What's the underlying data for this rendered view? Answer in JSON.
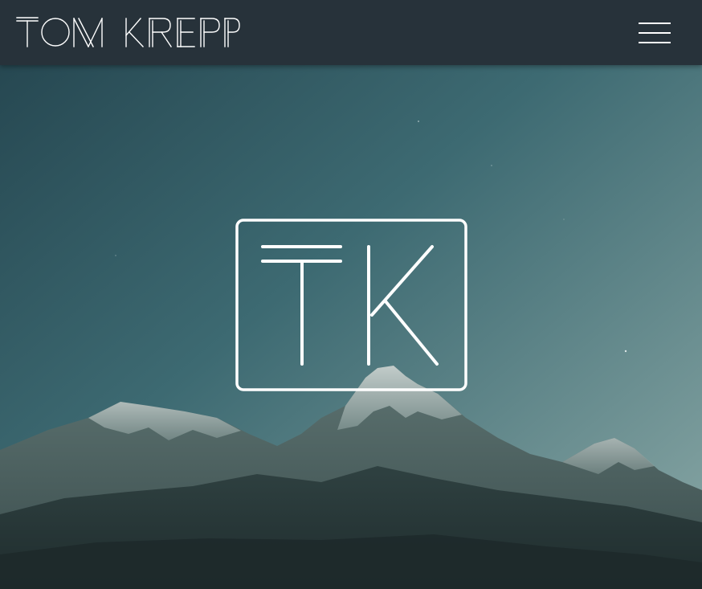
{
  "header": {
    "brand_name": "TOM KREPP",
    "menu_icon": "hamburger-menu-icon"
  },
  "hero": {
    "background_image": "mountain-landscape-photo",
    "monogram": "TK",
    "monogram_icon": "tk-monogram-logo"
  },
  "colors": {
    "header_bg": "#27323a",
    "sky_top": "#2b4c57",
    "sky_bottom": "#7ea0a0",
    "mountain_dark": "#2d3e3e",
    "logo_stroke": "#ffffff"
  }
}
